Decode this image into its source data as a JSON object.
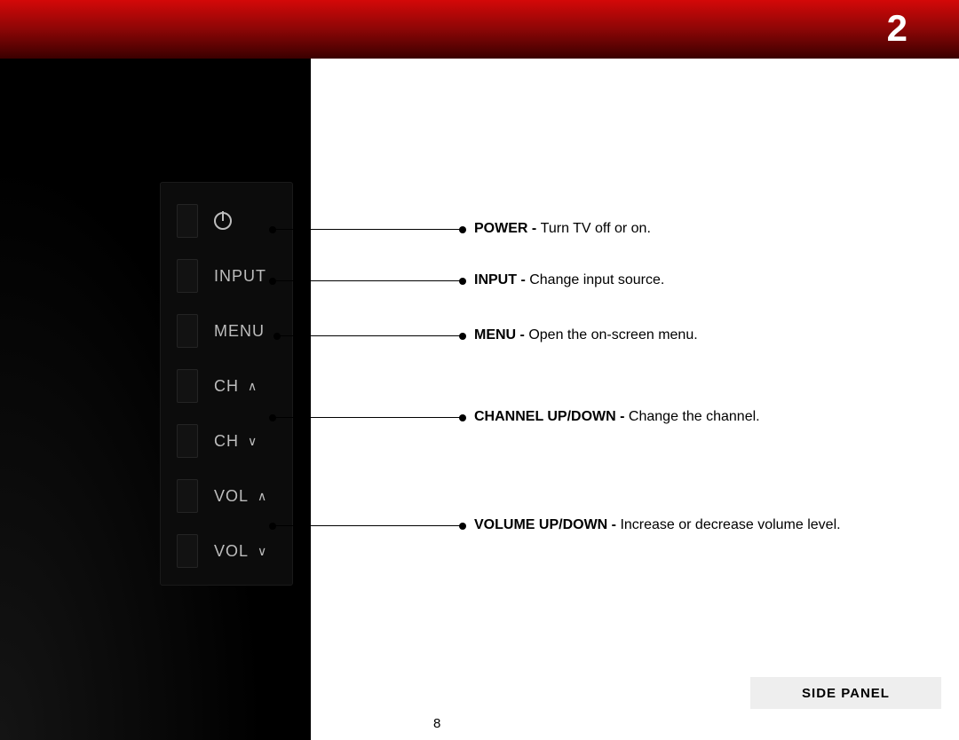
{
  "chapter_number": "2",
  "page_number": "8",
  "side_panel_label": "SIDE PANEL",
  "panel": {
    "input_label": "INPUT",
    "menu_label": "MENU",
    "ch_label": "CH",
    "vol_label": "VOL",
    "up_symbol": "∧",
    "down_symbol": "∨"
  },
  "callouts": {
    "power": {
      "bold": "POWER - ",
      "text": "Turn TV off or on."
    },
    "input": {
      "bold": "INPUT - ",
      "text": "Change input source."
    },
    "menu": {
      "bold": "MENU - ",
      "text": "Open the on-screen menu."
    },
    "channel": {
      "bold": "CHANNEL UP/DOWN - ",
      "text": "Change the channel."
    },
    "volume": {
      "bold": "VOLUME UP/DOWN - ",
      "text": "Increase or decrease volume level."
    }
  }
}
